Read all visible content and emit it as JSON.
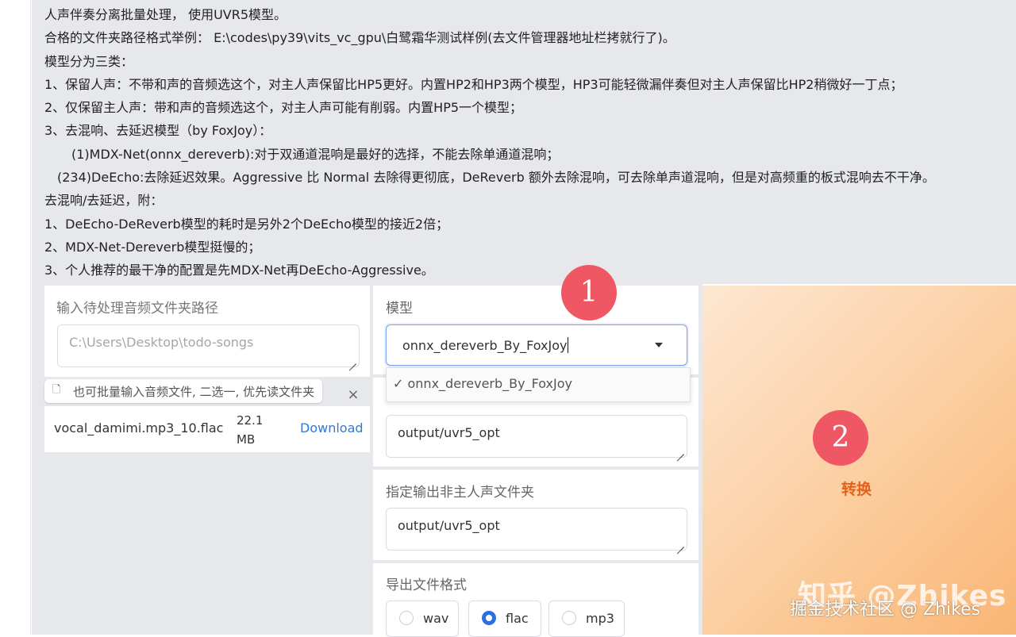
{
  "description": {
    "lines": [
      "人声伴奏分离批量处理， 使用UVR5模型。",
      "合格的文件夹路径格式举例： E:\\codes\\py39\\vits_vc_gpu\\白鹭霜华测试样例(去文件管理器地址栏拷就行了)。",
      "模型分为三类：",
      "1、保留人声：不带和声的音频选这个，对主人声保留比HP5更好。内置HP2和HP3两个模型，HP3可能轻微漏伴奏但对主人声保留比HP2稍微好一丁点；",
      "2、仅保留主人声：带和声的音频选这个，对主人声可能有削弱。内置HP5一个模型；",
      "3、去混响、去延迟模型（by FoxJoy）：",
      "(1)MDX-Net(onnx_dereverb):对于双通道混响是最好的选择，不能去除单通道混响；",
      "(234)DeEcho:去除延迟效果。Aggressive 比 Normal 去除得更彻底，DeReverb 额外去除混响，可去除单声道混响，但是对高频重的板式混响去不干净。",
      "去混响/去延迟，附：",
      "1、DeEcho-DeReverb模型的耗时是另外2个DeEcho模型的接近2倍；",
      "2、MDX-Net-Dereverb模型挺慢的；",
      "3、个人推荐的最干净的配置是先MDX-Net再DeEcho-Aggressive。"
    ]
  },
  "input_dir": {
    "label": "输入待处理音频文件夹路径",
    "value": "C:\\Users\\Desktop\\todo-songs"
  },
  "file_upload": {
    "tip": "也可批量输入音频文件, 二选一, 优先读文件夹",
    "close": "×",
    "file": {
      "name": "vocal_damimi.mp3_10.flac",
      "size": "22.1 MB",
      "download": "Download"
    }
  },
  "model": {
    "label": "模型",
    "selected": "onnx_dereverb_By_FoxJoy",
    "dropdown_option": "✓ onnx_dereverb_By_FoxJoy"
  },
  "vocal_output": {
    "value": "output/uvr5_opt"
  },
  "other_output": {
    "label": "指定输出非主人声文件夹",
    "value": "output/uvr5_opt"
  },
  "format": {
    "label": "导出文件格式",
    "options": [
      "wav",
      "flac",
      "mp3"
    ],
    "selected": "flac"
  },
  "convert_button": {
    "label": "转换"
  },
  "annotations": {
    "badge1": "1",
    "badge2": "2"
  },
  "watermark": {
    "line1": "知乎 @Zhikes",
    "line2": "掘金技术社区 @ Zhikes"
  },
  "colors": {
    "accent": "#2c6fe0",
    "convert_text": "#e3621a",
    "badge": "#f05764",
    "link": "#2d7bd6"
  }
}
